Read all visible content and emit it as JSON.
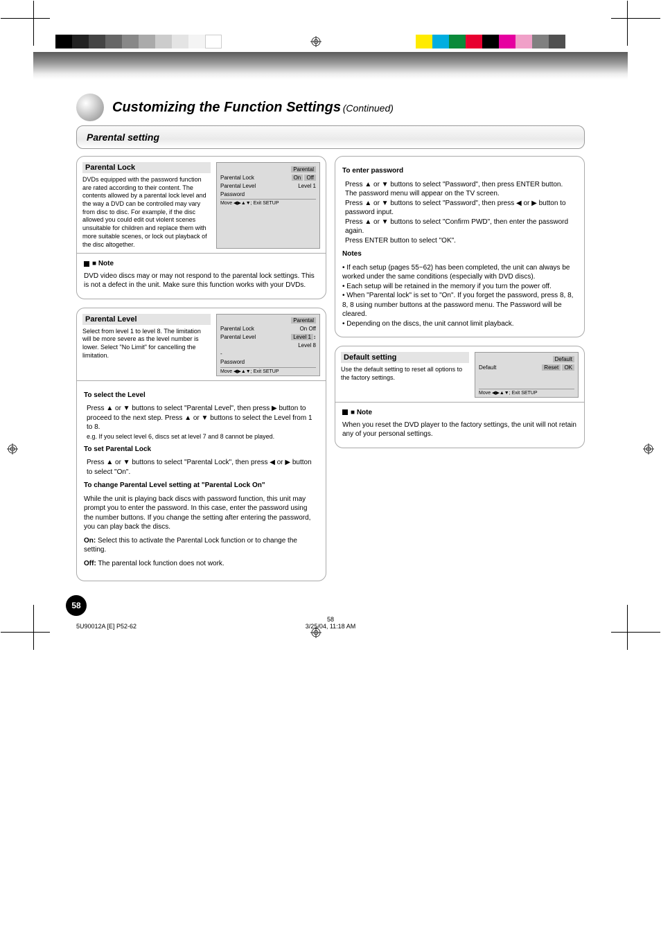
{
  "page_number": "58",
  "footer_caption": "5U90012A [E] P52-62",
  "footer_meta": "58\n3/25/04, 11:18 AM",
  "title": "Customizing the Function Settings",
  "subtitle": "(Continued)",
  "section_heading": "Parental setting",
  "card1": {
    "title": "Parental Lock",
    "subtitle": "DVDs equipped with the password function are rated according to their content. The contents allowed by a parental lock level and the way a DVD can be controlled may vary from disc to disc. For example, if the disc allowed you could edit out violent scenes unsuitable for children and replace them with more suitable scenes, or lock out playback of the disc altogether.",
    "note_heading": "■ Note",
    "note_text": "DVD video discs may or may not respond to the parental lock settings. This is not a defect in the unit. Make sure this function works with your DVDs.",
    "osd": {
      "top": "Parental",
      "row1_label": "Parental Lock",
      "on": "On",
      "off": "Off",
      "row2_label": "Parental Level",
      "row3_label": "Password",
      "right_label": "Level 1",
      "footer": "Move ◀▶▲▼;  Exit SETUP"
    }
  },
  "card2": {
    "title": "Parental Level",
    "subtitle": "Select from level 1 to level 8. The limitation will be more severe as the level number is lower. Select \"No Limit\" for cancelling the limitation.",
    "body": {
      "sel_level_title": "To select the Level",
      "sel_level_text": "Press ▲ or ▼ buttons to select \"Parental Level\", then press ▶ button to proceed to the next step. Press ▲ or ▼ buttons to select the Level from 1 to 8.",
      "sel_level_ex": "e.g. If you select level 6, discs set at level 7 and 8 cannot be played.",
      "set_lock_title": "To set Parental Lock",
      "set_lock_text": "Press ▲ or ▼ buttons to select \"Parental Lock\", then press ◀ or ▶ button to select \"On\".",
      "change_title": "To change Parental Level setting at \"Parental Lock On\"",
      "change_text": "While the unit is playing back discs with password function, this unit may prompt you to enter the password. In this case, enter the password using the number buttons. If you change the setting after entering the password, you can play back the discs.",
      "on": "On:",
      "on_text": "Select this to activate the Parental Lock function or to change the setting.",
      "off": "Off:",
      "off_text": "The parental lock function does not work."
    },
    "osd": {
      "top": "Parental",
      "row1_label": "Parental Lock",
      "on": "On",
      "off": "Off",
      "row2_label": "Parental Level",
      "hl": "Level 1",
      "level8": "Level 8",
      "row3_label": "Password",
      "footer": "Move ◀▶▲▼;  Exit SETUP"
    }
  },
  "card3": {
    "osd_present": false,
    "body": {
      "enter_title": "To enter password",
      "enter_text": "Press ▲ or ▼ buttons to select \"Password\", then press ENTER button.",
      "dialog_text": "The password menu will appear on the TV screen.",
      "press_text": "Press ▲ or ▼ buttons to select \"Password\", then press ◀ or ▶ button to password input.\nPress ▲ or ▼ buttons to select \"Confirm PWD\", then enter the password again.\nPress ENTER button to select \"OK\".",
      "notes_title": "Notes",
      "note1": "• If each setup (pages 55~62) has been completed, the unit can always be worked under the same conditions (especially with DVD discs).",
      "note2": "• Each setup will be retained in the memory if you turn the power off.",
      "note3": "• When \"Parental lock\" is set to \"On\". If you forget the password, press 8, 8, 8, 8 using number buttons at the password menu. The Password will be cleared.",
      "note4": "• Depending on the discs, the unit cannot limit playback."
    }
  },
  "card4": {
    "title": "Default setting",
    "subtitle": "Use the default setting to reset all options to the factory settings.",
    "note_heading": "■ Note",
    "note_text": "When you reset the DVD player to the factory settings, the unit will not retain any of your personal settings.",
    "osd": {
      "top": "Default",
      "row1_label": "Default",
      "reset": "Reset",
      "ok": "OK",
      "footer": "Move ◀▶▲▼;  Exit SETUP"
    }
  }
}
